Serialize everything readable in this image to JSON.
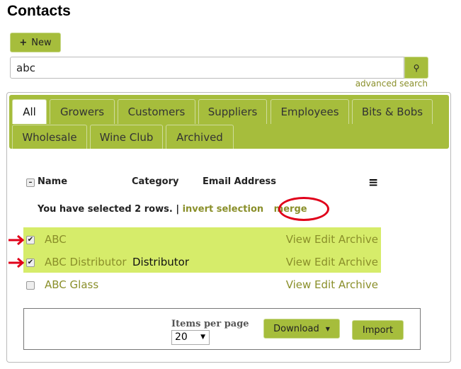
{
  "title": "Contacts",
  "new_button": "New",
  "search": {
    "value": "abc",
    "advanced_label": "advanced search"
  },
  "tabs": [
    "All",
    "Growers",
    "Customers",
    "Suppliers",
    "Employees",
    "Bits & Bobs",
    "Wholesale",
    "Wine Club",
    "Archived"
  ],
  "active_tab": "All",
  "columns": {
    "name": "Name",
    "category": "Category",
    "email": "Email Address"
  },
  "selection": {
    "text": "You have selected 2 rows.",
    "separator": "|",
    "invert": "invert selection",
    "merge": "merge"
  },
  "rows": [
    {
      "name": "ABC",
      "category": "",
      "checked": true,
      "actions": "View Edit Archive"
    },
    {
      "name": "ABC Distributor",
      "category": "Distributor",
      "checked": true,
      "actions": "View Edit Archive"
    },
    {
      "name": "ABC Glass",
      "category": "",
      "checked": false,
      "actions": "View Edit Archive"
    }
  ],
  "footer": {
    "items_per_page_label": "Items per page",
    "items_per_page": "20",
    "download": "Download",
    "import": "Import"
  },
  "colors": {
    "accent": "#a6bd3c",
    "highlight": "#d6ec6a",
    "link": "#8a8f2a",
    "annotation": "#e0001a"
  }
}
